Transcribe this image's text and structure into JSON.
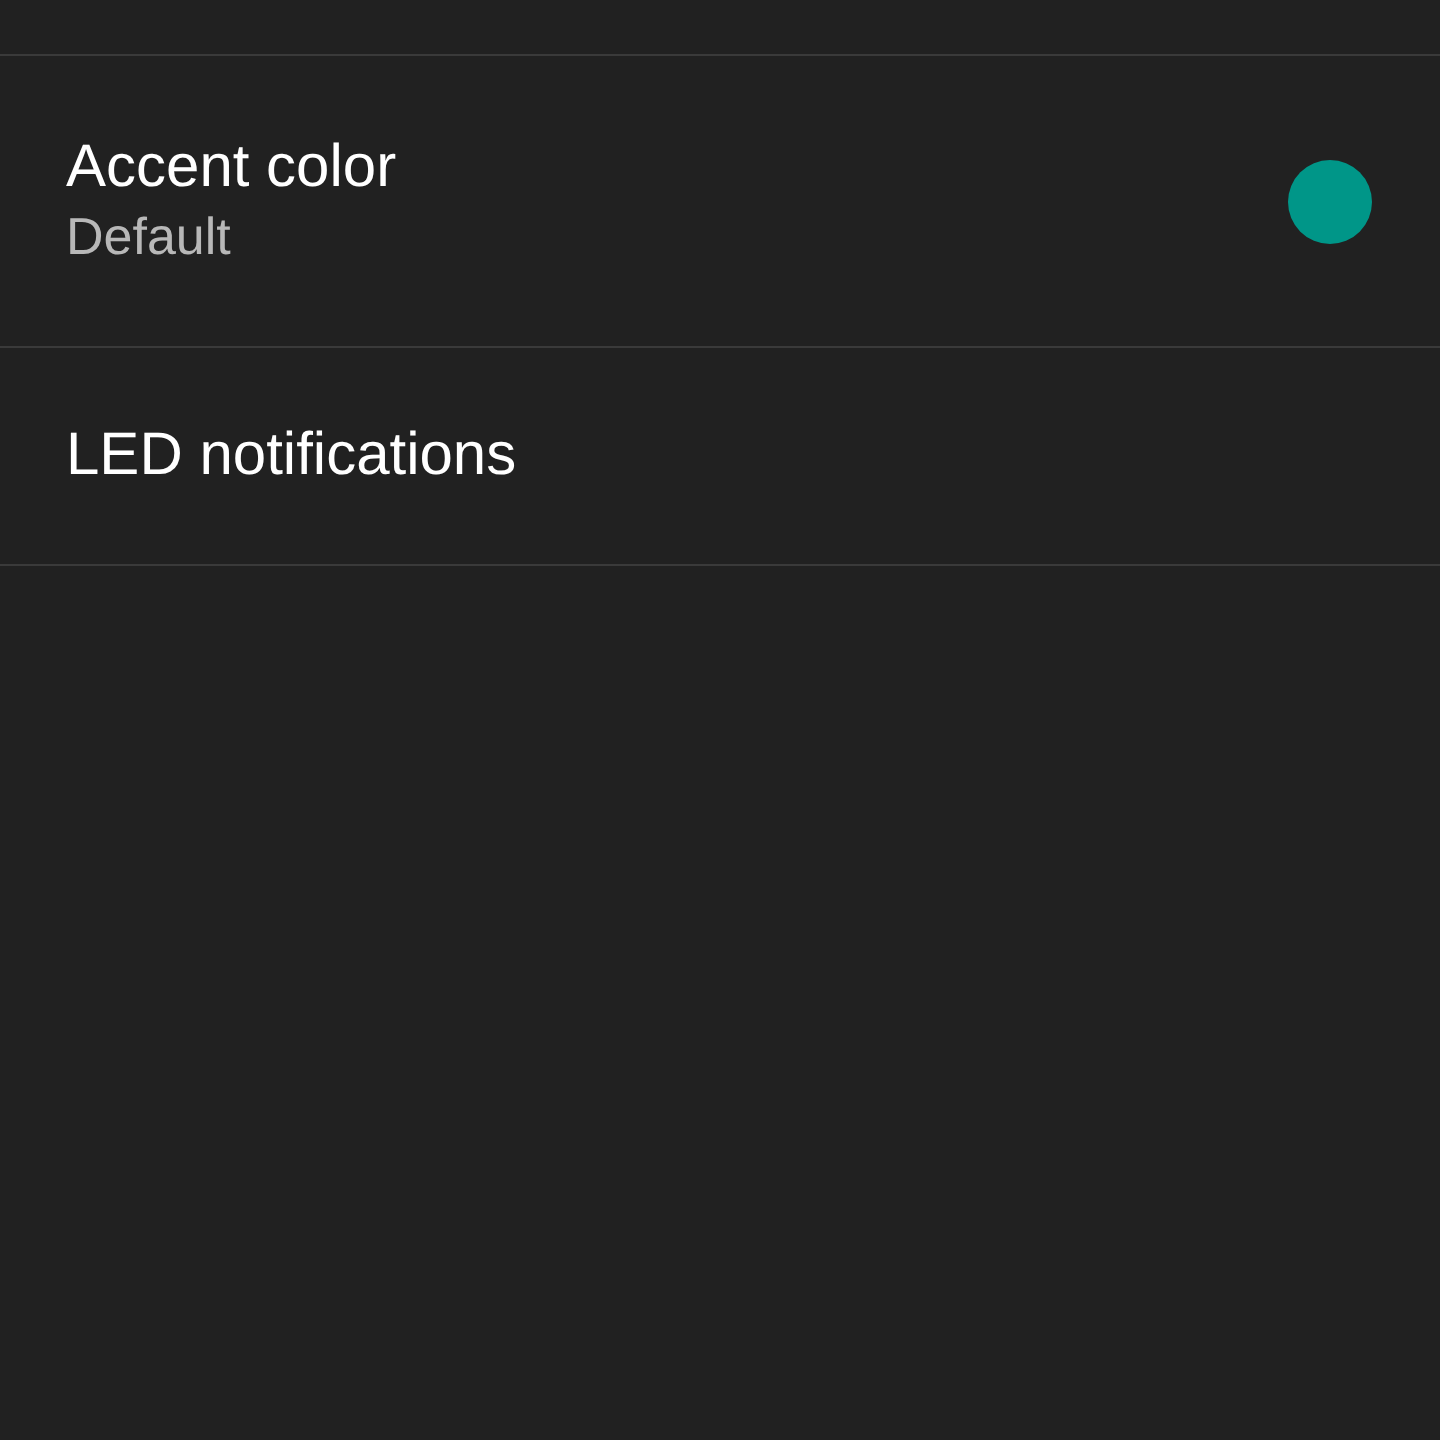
{
  "settings": [
    {
      "kind": "color",
      "title": "Accent color",
      "summary": "Default",
      "color": "#009688"
    },
    {
      "kind": "plain",
      "title": "LED notifications"
    }
  ]
}
